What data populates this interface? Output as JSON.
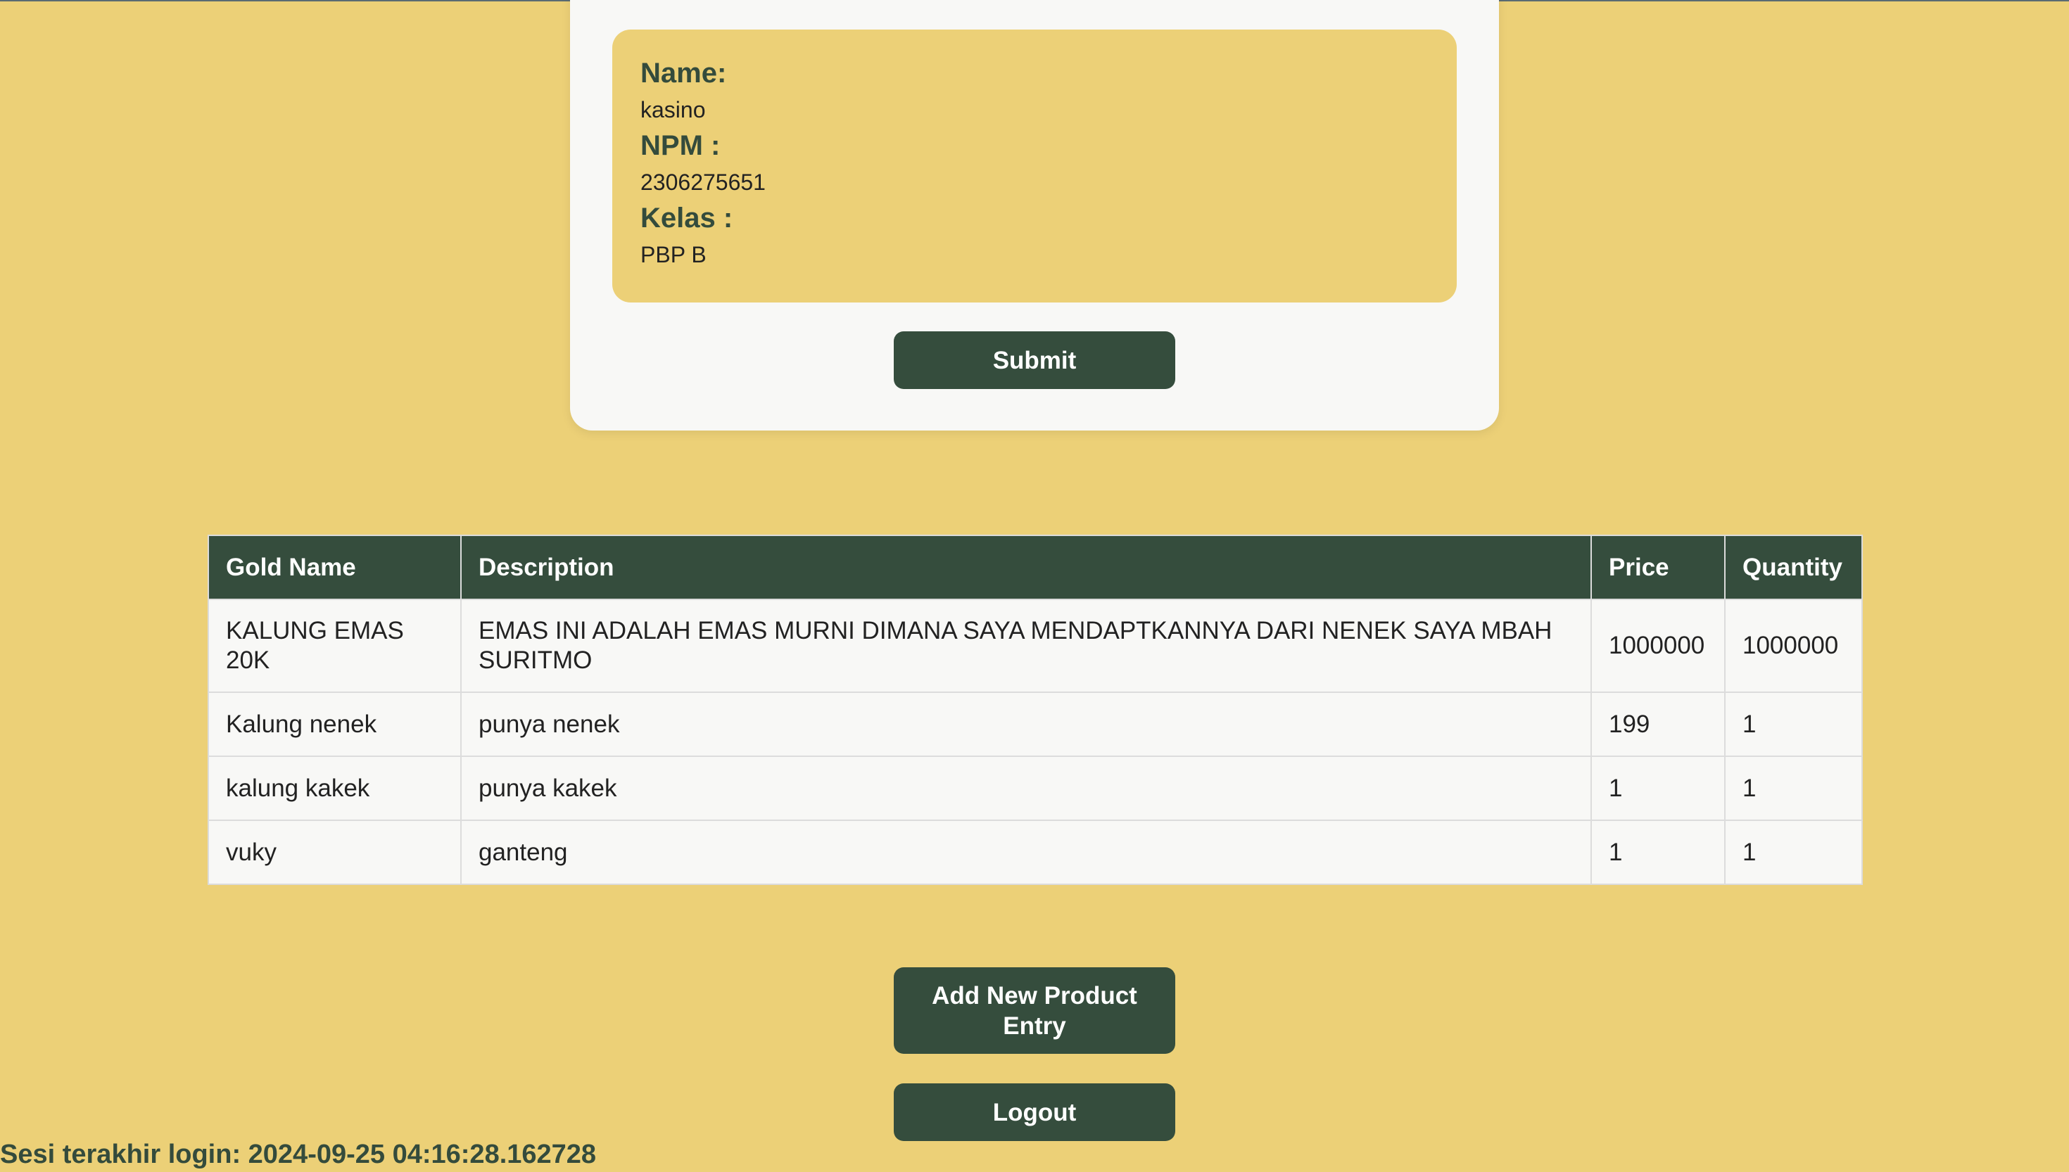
{
  "profile": {
    "name_label": "Name:",
    "name_value": "kasino",
    "npm_label": "NPM :",
    "npm_value": "2306275651",
    "kelas_label": "Kelas :",
    "kelas_value": "PBP B"
  },
  "form": {
    "submit_label": "Submit"
  },
  "table": {
    "headers": [
      "Gold Name",
      "Description",
      "Price",
      "Quantity"
    ],
    "rows": [
      [
        "KALUNG EMAS 20K",
        "EMAS INI ADALAH EMAS MURNI DIMANA SAYA MENDAPTKANNYA DARI NENEK SAYA MBAH SURITMO",
        "1000000",
        "1000000"
      ],
      [
        "Kalung nenek",
        "punya nenek",
        "199",
        "1"
      ],
      [
        "kalung kakek",
        "punya kakek",
        "1",
        "1"
      ],
      [
        "vuky",
        "ganteng",
        "1",
        "1"
      ]
    ]
  },
  "actions": {
    "add_label": "Add New Product Entry",
    "logout_label": "Logout"
  },
  "footer": {
    "last_login_label": "Sesi terakhir login:",
    "last_login_value": "2024-09-25 04:16:28.162728"
  },
  "colors": {
    "background": "#ECD077",
    "primary": "#354D3D",
    "card": "#F8F8F6"
  }
}
